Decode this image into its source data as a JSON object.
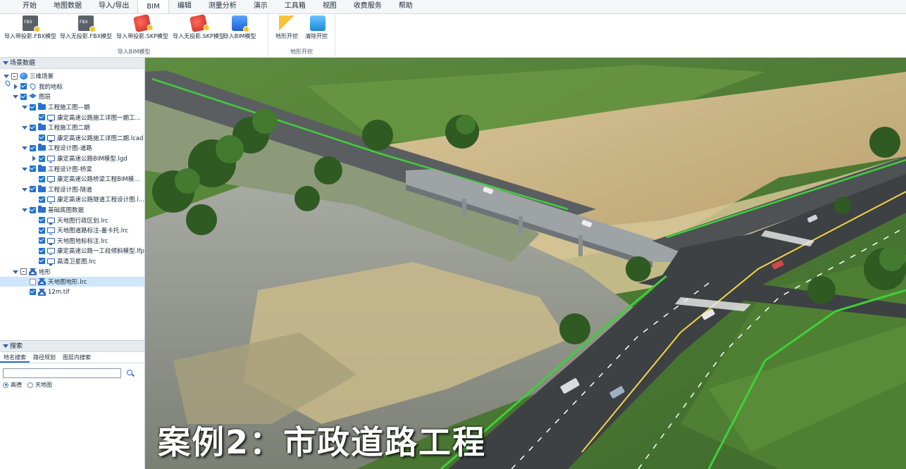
{
  "menu": {
    "tabs": [
      {
        "label": "开始"
      },
      {
        "label": "地图数据"
      },
      {
        "label": "导入/导出"
      },
      {
        "label": "BIM"
      },
      {
        "label": "编辑"
      },
      {
        "label": "测量分析"
      },
      {
        "label": "演示"
      },
      {
        "label": "工具箱"
      },
      {
        "label": "视图"
      },
      {
        "label": "收费服务"
      },
      {
        "label": "帮助"
      }
    ],
    "active": "BIM"
  },
  "ribbon": {
    "groups": [
      {
        "title": "导入BIM模型",
        "buttons": [
          {
            "label": "导入带投影.FBX模型",
            "icon": "fbx-icon"
          },
          {
            "label": "导入无投影.FBX模型",
            "icon": "fbx-icon"
          },
          {
            "label": "导入带投影.SKP模型",
            "icon": "skp-icon"
          },
          {
            "label": "导入无投影.SKP模型",
            "icon": "skp-icon"
          },
          {
            "label": "导入BIM模型",
            "icon": "bim-icon"
          }
        ]
      },
      {
        "title": "地形开挖",
        "buttons": [
          {
            "label": "地形开挖",
            "icon": "terrain-dig-icon"
          },
          {
            "label": "清除开挖",
            "icon": "clear-dig-icon"
          }
        ]
      }
    ]
  },
  "scene_panel": {
    "title": "场景数据",
    "tree": [
      {
        "label": "三维场景",
        "level": 0,
        "expander": "open",
        "check": "square",
        "icon": "globe-icon"
      },
      {
        "label": "我的地标",
        "level": 1,
        "expander": "closed",
        "check": "checked",
        "icon": "pin-icon"
      },
      {
        "label": "图层",
        "level": 1,
        "expander": "open",
        "check": "checked",
        "icon": "layers-icon"
      },
      {
        "label": "工程施工图—期",
        "level": 2,
        "expander": "open",
        "check": "checked",
        "icon": "folder-icon"
      },
      {
        "label": "康定高速公路施工详图一期工...",
        "level": 3,
        "expander": "",
        "check": "checked",
        "icon": "monitor-icon"
      },
      {
        "label": "工程施工图二期",
        "level": 2,
        "expander": "open",
        "check": "checked",
        "icon": "folder-icon"
      },
      {
        "label": "康定高速公路施工详图二期.lcad",
        "level": 3,
        "expander": "",
        "check": "checked",
        "icon": "monitor-icon"
      },
      {
        "label": "工程设计图-道路",
        "level": 2,
        "expander": "open",
        "check": "checked",
        "icon": "folder-icon"
      },
      {
        "label": "康定高速公路BIM模型.lgd",
        "level": 3,
        "expander": "closed",
        "check": "checked",
        "icon": "monitor-icon"
      },
      {
        "label": "工程设计图-桥梁",
        "level": 2,
        "expander": "open",
        "check": "checked",
        "icon": "folder-icon"
      },
      {
        "label": "康定高速公路桥梁工程BIM模...",
        "level": 3,
        "expander": "",
        "check": "checked",
        "icon": "monitor-icon"
      },
      {
        "label": "工程设计图-隧道",
        "level": 2,
        "expander": "open",
        "check": "checked",
        "icon": "folder-icon"
      },
      {
        "label": "康定高速公路隧道工程设计图.l...",
        "level": 3,
        "expander": "",
        "check": "checked",
        "icon": "monitor-icon"
      },
      {
        "label": "基础底图数据",
        "level": 2,
        "expander": "open",
        "check": "checked",
        "icon": "folder-icon"
      },
      {
        "label": "天地图行政区划.lrc",
        "level": 3,
        "expander": "",
        "check": "checked",
        "icon": "monitor-icon"
      },
      {
        "label": "天地图道路标注-墨卡托.lrc",
        "level": 3,
        "expander": "",
        "check": "checked",
        "icon": "monitor-icon"
      },
      {
        "label": "天地图地标标注.lrc",
        "level": 3,
        "expander": "",
        "check": "checked",
        "icon": "monitor-icon"
      },
      {
        "label": "康定高速公路一工段倾斜模型.lfp",
        "level": 3,
        "expander": "",
        "check": "checked",
        "icon": "monitor-icon"
      },
      {
        "label": "高清卫星图.lrc",
        "level": 3,
        "expander": "",
        "check": "checked",
        "icon": "monitor-icon"
      },
      {
        "label": "地形",
        "level": 1,
        "expander": "open",
        "check": "square",
        "icon": "terrain-icon"
      },
      {
        "label": "天地图地形.lrc",
        "level": 2,
        "expander": "",
        "check": "empty",
        "icon": "terrain-icon",
        "selected": true
      },
      {
        "label": "12m.tif",
        "level": 2,
        "expander": "",
        "check": "checked",
        "icon": "terrain-icon"
      }
    ]
  },
  "search_panel": {
    "title": "搜索",
    "tabs": [
      {
        "label": "地名搜索"
      },
      {
        "label": "路径规划"
      },
      {
        "label": "图层内搜索"
      }
    ],
    "active_tab": "地名搜索",
    "input_value": "",
    "radios": [
      {
        "label": "高德",
        "checked": true
      },
      {
        "label": "天地图",
        "checked": false
      }
    ]
  },
  "map_view": {
    "overlay_title": "案例2：市政道路工程"
  }
}
